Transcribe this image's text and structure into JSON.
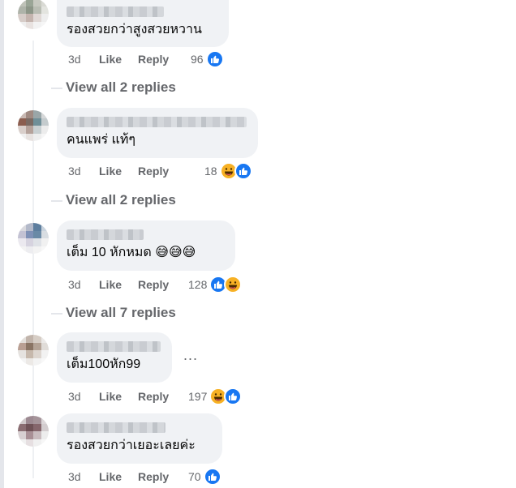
{
  "comments": [
    {
      "text": "รองสวยกว่าสูงสวยหวาน",
      "time": "3d",
      "like_label": "Like",
      "reply_label": "Reply",
      "reaction_count": "96",
      "reactions": [
        "like"
      ],
      "view_replies": "View all 2 replies"
    },
    {
      "text": "คนแพร่ แท้ๆ",
      "time": "3d",
      "like_label": "Like",
      "reply_label": "Reply",
      "reaction_count": "18",
      "reactions": [
        "haha",
        "like"
      ],
      "view_replies": "View all 2 replies"
    },
    {
      "text": "เต็ม 10 หักหมด 😅😅😅",
      "time": "3d",
      "like_label": "Like",
      "reply_label": "Reply",
      "reaction_count": "128",
      "reactions": [
        "like",
        "haha"
      ],
      "view_replies": "View all 7 replies"
    },
    {
      "text": "เต็ม100หัก99",
      "time": "3d",
      "like_label": "Like",
      "reply_label": "Reply",
      "reaction_count": "197",
      "reactions": [
        "haha",
        "like"
      ],
      "more_label": "..."
    },
    {
      "text": "รองสวยกว่าเยอะเลยค่ะ",
      "time": "3d",
      "like_label": "Like",
      "reply_label": "Reply",
      "reaction_count": "70",
      "reactions": [
        "like"
      ]
    }
  ],
  "colors": {
    "like_blue": "#1877f2",
    "haha_yellow": "#f7b125",
    "bubble_bg": "#f0f2f5",
    "meta_gray": "#65676b"
  }
}
